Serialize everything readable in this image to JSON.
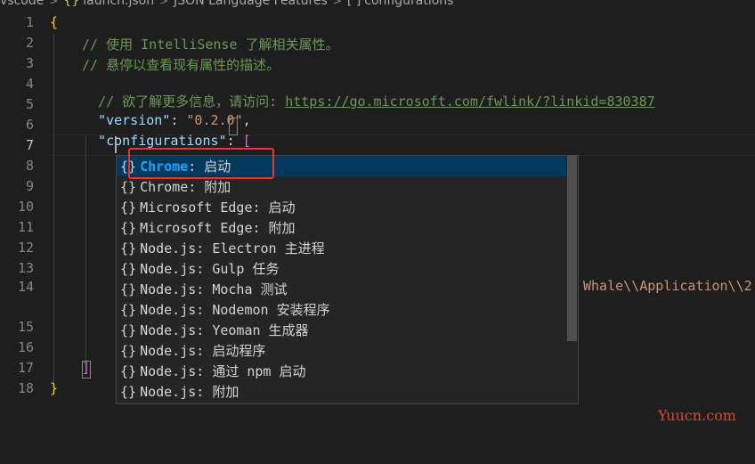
{
  "breadcrumb": {
    "items": [
      "vscode",
      "launch.json",
      "JSON Language Features",
      "configurations"
    ],
    "json_icon": "{}",
    "array_icon": "[ ]"
  },
  "editor": {
    "line_numbers": [
      "1",
      "2",
      "3",
      "4",
      "5",
      "6",
      "7",
      "8",
      "9",
      "10",
      "11",
      "12",
      "13",
      "14",
      "15",
      "16",
      "17",
      "18"
    ],
    "lines": {
      "l1": "{",
      "l2": "// 使用 IntelliSense 了解相关属性。",
      "l3": "// 悬停以查看现有属性的描述。",
      "l4_prefix": "// 欲了解更多信息，请访问: ",
      "l4_link": "https://go.microsoft.com/fwlink/?linkid=830387",
      "l5_key": "\"version\"",
      "l5_colon": ": ",
      "l5_value": "\"0.2.0\"",
      "l5_comma": ",",
      "l6_key": "\"configurations\"",
      "l6_colon": ": ",
      "l6_bracket": "[",
      "l17_bracket": "]",
      "l18": "}",
      "line14_overflow": "Whale\\\\Application\\\\2"
    }
  },
  "suggest": {
    "icon": "{}",
    "items": [
      {
        "label_match": "Chrome",
        "label_rest": ": 启动"
      },
      {
        "label_match": "",
        "label_rest": "Chrome: 附加"
      },
      {
        "label_match": "",
        "label_rest": "Microsoft Edge: 启动"
      },
      {
        "label_match": "",
        "label_rest": "Microsoft Edge: 附加"
      },
      {
        "label_match": "",
        "label_rest": "Node.js: Electron 主进程"
      },
      {
        "label_match": "",
        "label_rest": "Node.js: Gulp 任务"
      },
      {
        "label_match": "",
        "label_rest": "Node.js: Mocha 测试"
      },
      {
        "label_match": "",
        "label_rest": "Node.js: Nodemon 安装程序"
      },
      {
        "label_match": "",
        "label_rest": "Node.js: Yeoman 生成器"
      },
      {
        "label_match": "",
        "label_rest": "Node.js: 启动程序"
      },
      {
        "label_match": "",
        "label_rest": "Node.js: 通过 npm 启动"
      },
      {
        "label_match": "",
        "label_rest": "Node.js: 附加"
      }
    ]
  },
  "watermark": "Yuucn.com"
}
